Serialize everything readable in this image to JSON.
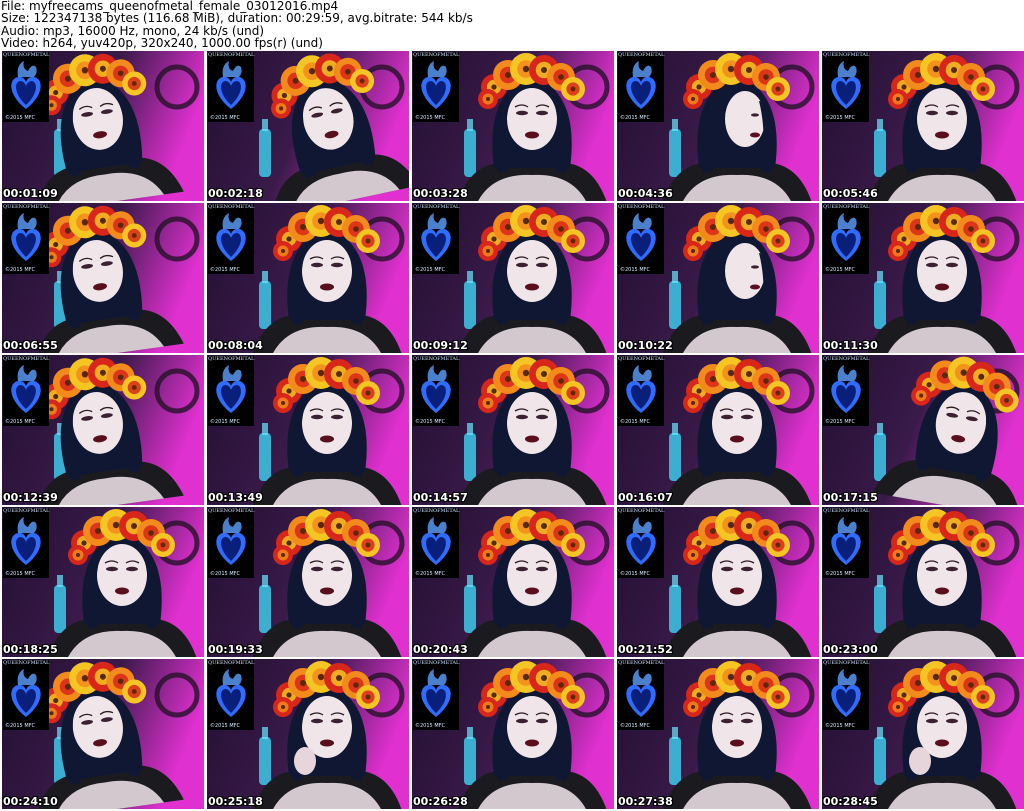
{
  "header": {
    "file_line": "File: myfreecams_queenofmetal_female_03012016.mp4",
    "size_line": "Size: 122347138 bytes (116.68 MiB), duration: 00:29:59, avg.bitrate: 544 kb/s",
    "audio_line": "Audio: mp3, 16000 Hz, mono, 24 kb/s (und)",
    "video_line": "Video: h264, yuv420p, 320x240, 1000.00 fps(r) (und)"
  },
  "logo": {
    "title": "QUEENOFMETAL",
    "copyright": "©2015 MFC"
  },
  "colors": {
    "flower_red": "#d8261a",
    "flower_orange": "#f28a1c",
    "flower_yellow": "#f5c623",
    "hair": "#101733",
    "skin": "#f0e6ea",
    "lips": "#5a0f1e",
    "background_purple": "#3a1a4a",
    "background_magenta": "#e030d0",
    "heart_blue": "#2f6cff"
  },
  "frames": [
    {
      "timestamp": "00:01:09",
      "variant": "leftdown"
    },
    {
      "timestamp": "00:02:18",
      "variant": "tilt"
    },
    {
      "timestamp": "00:03:28",
      "variant": "center"
    },
    {
      "timestamp": "00:04:36",
      "variant": "profile"
    },
    {
      "timestamp": "00:05:46",
      "variant": "center"
    },
    {
      "timestamp": "00:06:55",
      "variant": "left"
    },
    {
      "timestamp": "00:08:04",
      "variant": "center"
    },
    {
      "timestamp": "00:09:12",
      "variant": "center"
    },
    {
      "timestamp": "00:10:22",
      "variant": "profile"
    },
    {
      "timestamp": "00:11:30",
      "variant": "center"
    },
    {
      "timestamp": "00:12:39",
      "variant": "left"
    },
    {
      "timestamp": "00:13:49",
      "variant": "center"
    },
    {
      "timestamp": "00:14:57",
      "variant": "center"
    },
    {
      "timestamp": "00:16:07",
      "variant": "center"
    },
    {
      "timestamp": "00:17:15",
      "variant": "right"
    },
    {
      "timestamp": "00:18:25",
      "variant": "center"
    },
    {
      "timestamp": "00:19:33",
      "variant": "center"
    },
    {
      "timestamp": "00:20:43",
      "variant": "center"
    },
    {
      "timestamp": "00:21:52",
      "variant": "center"
    },
    {
      "timestamp": "00:23:00",
      "variant": "center"
    },
    {
      "timestamp": "00:24:10",
      "variant": "left"
    },
    {
      "timestamp": "00:25:18",
      "variant": "hand"
    },
    {
      "timestamp": "00:26:28",
      "variant": "center"
    },
    {
      "timestamp": "00:27:38",
      "variant": "center"
    },
    {
      "timestamp": "00:28:45",
      "variant": "hand"
    }
  ]
}
